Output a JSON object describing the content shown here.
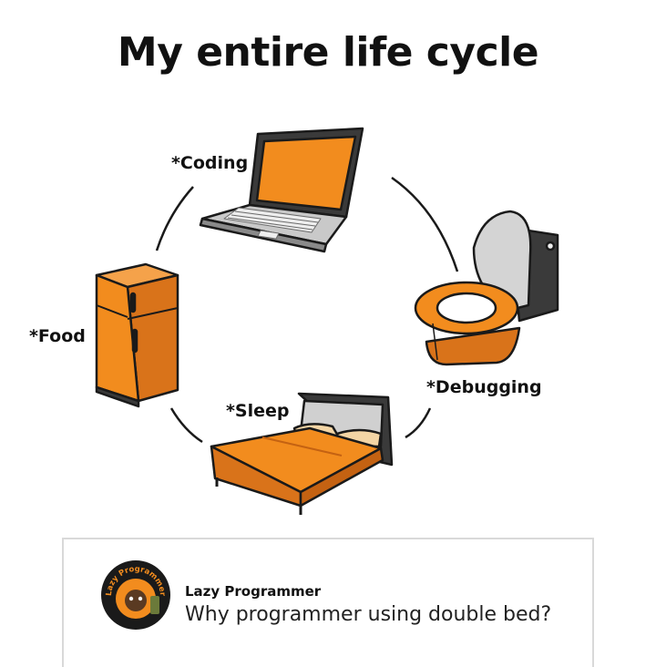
{
  "title": "My entire life cycle",
  "cycle": {
    "items": [
      {
        "label": "*Coding",
        "icon": "laptop-icon"
      },
      {
        "label": "*Debugging",
        "icon": "toilet-icon"
      },
      {
        "label": "*Sleep",
        "icon": "bed-icon"
      },
      {
        "label": "*Food",
        "icon": "fridge-icon"
      }
    ]
  },
  "comment": {
    "author": "Lazy Programmer",
    "avatar_text": "Lazy Programmer",
    "message": "Why programmer using double bed?"
  },
  "colors": {
    "accent": "#F28C1E",
    "accent_dark": "#D9731A",
    "outline": "#1a1a1a",
    "gray": "#9a9a9a",
    "dark_gray": "#3a3a3a"
  }
}
